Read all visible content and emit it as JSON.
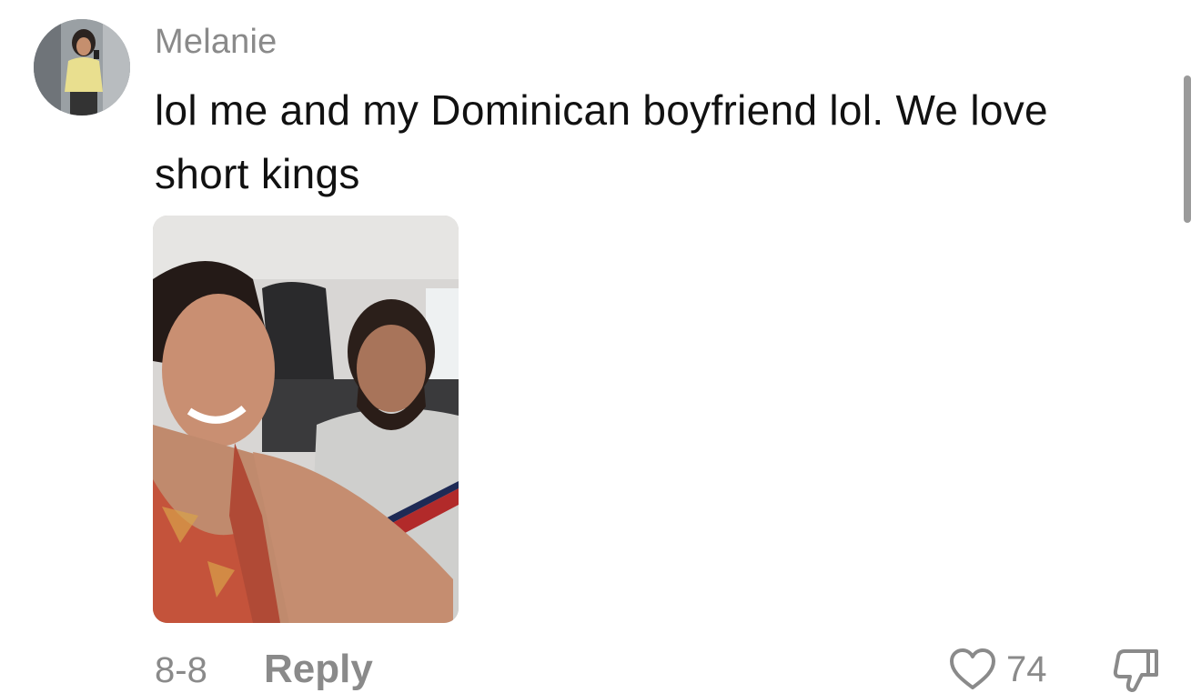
{
  "comment": {
    "username": "Melanie",
    "text": "lol me and my Dominican boyfriend lol. We love short kings",
    "date": "8-8",
    "reply_label": "Reply",
    "like_count": "74"
  },
  "icons": {
    "like": "heart-outline-icon",
    "dislike": "thumbs-down-outline-icon"
  },
  "colors": {
    "username": "#8a8a8a",
    "text": "#111111",
    "meta": "#8a8a8a"
  }
}
